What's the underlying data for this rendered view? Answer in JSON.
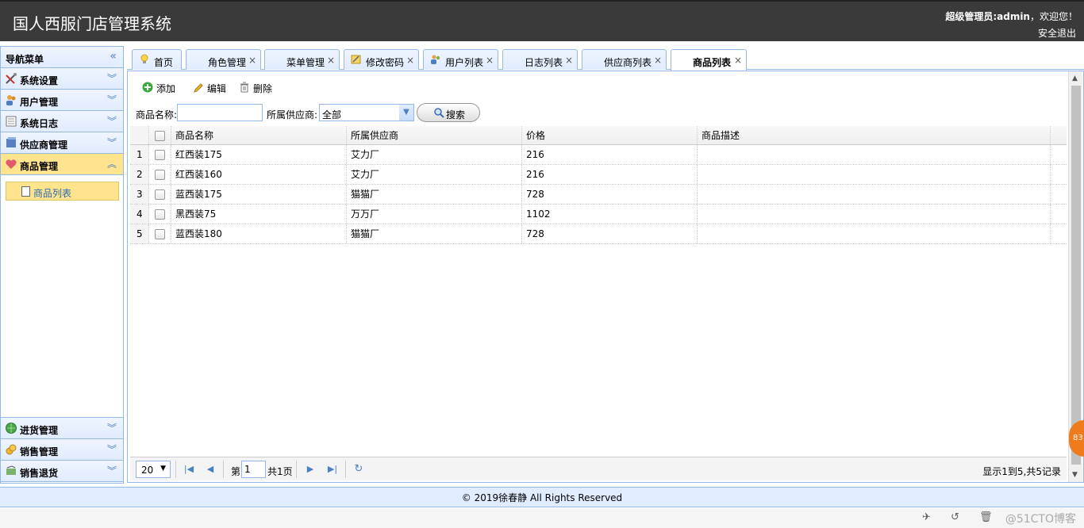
{
  "header": {
    "title": "国人西服门店管理系统",
    "user_role_name": "超级管理员:admin",
    "welcome": "，欢迎您！",
    "logout_label": "安全退出"
  },
  "nav": {
    "title": "导航菜单",
    "sections_top": [
      {
        "label": "系统设置",
        "icon": "tools-icon"
      },
      {
        "label": "用户管理",
        "icon": "users-icon"
      },
      {
        "label": "系统日志",
        "icon": "log-icon"
      },
      {
        "label": "供应商管理",
        "icon": "supplier-icon"
      },
      {
        "label": "商品管理",
        "icon": "heart-icon"
      }
    ],
    "active_sub_item": "商品列表",
    "sections_bottom": [
      {
        "label": "进货管理",
        "icon": "globe-icon"
      },
      {
        "label": "销售管理",
        "icon": "coins-icon"
      },
      {
        "label": "销售退货",
        "icon": "return-icon"
      }
    ]
  },
  "tabs": [
    {
      "label": "首页",
      "closable": false
    },
    {
      "label": "角色管理",
      "closable": true
    },
    {
      "label": "菜单管理",
      "closable": true
    },
    {
      "label": "修改密码",
      "closable": true
    },
    {
      "label": "用户列表",
      "closable": true
    },
    {
      "label": "日志列表",
      "closable": true
    },
    {
      "label": "供应商列表",
      "closable": true
    },
    {
      "label": "商品列表",
      "closable": true,
      "active": true
    }
  ],
  "toolbar": {
    "add_label": "添加",
    "edit_label": "编辑",
    "delete_label": "删除"
  },
  "search": {
    "name_label": "商品名称:",
    "name_value": "",
    "supplier_label": "所属供应商:",
    "supplier_value": "全部",
    "search_label": "搜索"
  },
  "grid": {
    "columns": [
      "商品名称",
      "所属供应商",
      "价格",
      "商品描述"
    ],
    "rows": [
      {
        "no": "1",
        "name": "红西装175",
        "supplier": "艾力厂",
        "price": "216",
        "desc": ""
      },
      {
        "no": "2",
        "name": "红西装160",
        "supplier": "艾力厂",
        "price": "216",
        "desc": ""
      },
      {
        "no": "3",
        "name": "蓝西装175",
        "supplier": "猫猫厂",
        "price": "728",
        "desc": ""
      },
      {
        "no": "4",
        "name": "黑西装75",
        "supplier": "万万厂",
        "price": "1102",
        "desc": ""
      },
      {
        "no": "5",
        "name": "蓝西装180",
        "supplier": "猫猫厂",
        "price": "728",
        "desc": ""
      }
    ]
  },
  "pager": {
    "page_size": "20",
    "page_label": "第",
    "page_number": "1",
    "total_label": "共1页",
    "info": "显示1到5,共5记录"
  },
  "footer": {
    "copyright": "© 2019徐春静 All Rights Reserved",
    "watermark": "@51CTO博客"
  },
  "badge": "83",
  "colors": {
    "header_bg": "#3a3a3a",
    "panel_border": "#95b8e7",
    "accordion_bg": "#e0ecff",
    "active_highlight": "#ffe48d"
  }
}
